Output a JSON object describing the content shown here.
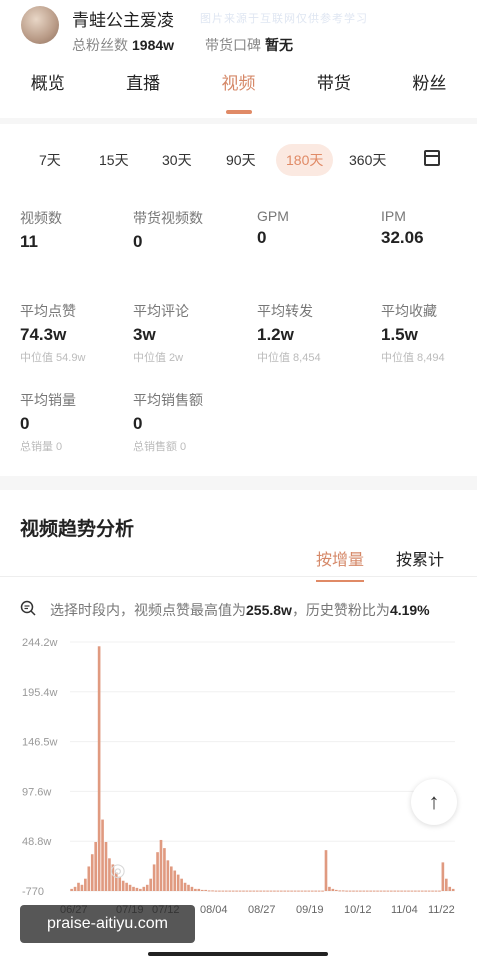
{
  "profile": {
    "name": "青蛙公主爱凌",
    "fans_label": "总粉丝数",
    "fans_value": "1984w",
    "reputation_label": "带货口碑",
    "reputation_value": "暂无"
  },
  "tabs": [
    {
      "label": "概览"
    },
    {
      "label": "直播"
    },
    {
      "label": "视频",
      "active": true
    },
    {
      "label": "带货"
    },
    {
      "label": "粉丝"
    }
  ],
  "ranges": [
    {
      "label": "7天"
    },
    {
      "label": "15天"
    },
    {
      "label": "30天"
    },
    {
      "label": "90天"
    },
    {
      "label": "180天",
      "active": true
    },
    {
      "label": "360天"
    }
  ],
  "calendar_icon": "calendar-icon",
  "stats": {
    "video_count": {
      "label": "视频数",
      "value": "11"
    },
    "goods_video_count": {
      "label": "带货视频数",
      "value": "0"
    },
    "gpm": {
      "label": "GPM",
      "value": "0"
    },
    "ipm": {
      "label": "IPM",
      "value": "32.06"
    },
    "avg_like": {
      "label": "平均点赞",
      "value": "74.3w",
      "sub": "中位值 54.9w"
    },
    "avg_comment": {
      "label": "平均评论",
      "value": "3w",
      "sub": "中位值 2w"
    },
    "avg_share": {
      "label": "平均转发",
      "value": "1.2w",
      "sub": "中位值 8,454"
    },
    "avg_fav": {
      "label": "平均收藏",
      "value": "1.5w",
      "sub": "中位值 8,494"
    },
    "avg_sales": {
      "label": "平均销量",
      "value": "0",
      "sub": "总销量 0"
    },
    "avg_sales_amount": {
      "label": "平均销售额",
      "value": "0",
      "sub": "总销售额 0"
    }
  },
  "trend": {
    "title": "视频趋势分析",
    "mode_increment": "按增量",
    "mode_cumulative": "按累计",
    "insight_prefix": "选择时段内，视频点赞最高值为",
    "insight_max": "255.8w",
    "insight_mid": "，历史赞粉比为",
    "insight_ratio": "4.19%"
  },
  "chart_data": {
    "type": "bar",
    "y_ticks": [
      "244.2w",
      "195.4w",
      "146.5w",
      "97.6w",
      "48.8w",
      "-770"
    ],
    "x_ticks": [
      "06/27",
      "07/19",
      "07/12",
      "08/04",
      "08/27",
      "09/19",
      "10/12",
      "11/04",
      "11/22"
    ],
    "ylim": [
      -0.077,
      244.2
    ],
    "bar_color": "#e09a80",
    "series": [
      {
        "values": [
          2,
          4,
          8,
          6,
          12,
          24,
          36,
          48,
          240,
          70,
          48,
          32,
          26,
          18,
          14,
          10,
          8,
          6,
          4,
          3,
          2,
          4,
          6,
          12,
          26,
          38,
          50,
          42,
          30,
          24,
          20,
          16,
          12,
          8,
          6,
          4,
          2,
          2,
          1,
          1,
          0.5,
          0.5,
          0.3,
          0.3,
          0.2,
          0.2,
          0.2,
          0.1,
          0.1,
          0.1,
          0,
          0,
          0.1,
          0.1,
          0.1,
          0.1,
          0,
          0,
          0,
          0,
          0,
          0,
          0,
          0,
          0,
          0,
          0,
          0,
          0,
          0,
          0,
          0,
          0,
          0,
          40,
          4,
          2,
          1,
          0.5,
          0.5,
          0,
          0,
          0,
          0,
          0,
          0,
          0,
          0,
          0,
          0,
          0,
          0,
          0,
          0,
          0,
          0,
          0,
          0,
          0,
          0,
          0,
          0,
          0,
          0,
          0,
          0,
          0,
          0,
          28,
          12,
          4,
          2
        ]
      }
    ]
  },
  "back_to_top": "↑",
  "watermark": "praise-aitiyu.com",
  "noise": "图片来源于互联网仅供参考学习"
}
